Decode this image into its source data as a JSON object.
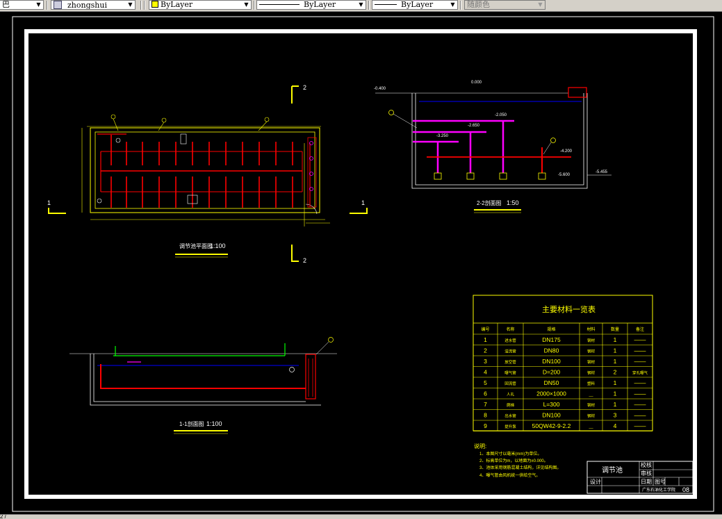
{
  "toolbar": {
    "left_fragment": "巴",
    "textstyle_value": "zhongshui",
    "layer_value": "ByLayer",
    "linetype_value": "ByLayer",
    "lineweight_value": "ByLayer",
    "plotstyle_value": "随颜色"
  },
  "statusbar": {
    "text": "2 /"
  },
  "drawing": {
    "plan": {
      "title": "调节池平面图",
      "scale": "1:100",
      "mark_left": "1",
      "mark_right": "1",
      "mark_top": "2",
      "mark_bottom": "2"
    },
    "section_11": {
      "title": "1-1剖面图",
      "scale": "1:100"
    },
    "section_22": {
      "title": "2-2剖面图",
      "scale": "1:50",
      "levels": {
        "top_left": "-0.400",
        "top": "0.000",
        "l1": "-2.050",
        "l2": "-2.650",
        "l3": "-3.250",
        "l4": "-4.200",
        "l5": "-5.600",
        "l6": "-5.455"
      }
    },
    "materials": {
      "title": "主要材料一览表",
      "headers": [
        "编号",
        "名称",
        "规格",
        "材料",
        "数量",
        "备注"
      ],
      "rows": [
        {
          "no": "1",
          "name": "进水管",
          "spec": "DN175",
          "mat": "钢材",
          "qty": "1",
          "note": "——"
        },
        {
          "no": "2",
          "name": "溢流管",
          "spec": "DN80",
          "mat": "钢材",
          "qty": "1",
          "note": "——"
        },
        {
          "no": "3",
          "name": "放空管",
          "spec": "DN100",
          "mat": "钢材",
          "qty": "1",
          "note": "——"
        },
        {
          "no": "4",
          "name": "曝气管",
          "spec": "D=200",
          "mat": "钢材",
          "qty": "2",
          "note": "穿孔曝气"
        },
        {
          "no": "5",
          "name": "回流管",
          "spec": "DN50",
          "mat": "塑料",
          "qty": "1",
          "note": "——"
        },
        {
          "no": "6",
          "name": "人孔",
          "spec": "2000×1000",
          "mat": "__",
          "qty": "1",
          "note": "——"
        },
        {
          "no": "7",
          "name": "爬梯",
          "spec": "L=300",
          "mat": "钢材",
          "qty": "1",
          "note": "——"
        },
        {
          "no": "8",
          "name": "出水管",
          "spec": "DN100",
          "mat": "钢材",
          "qty": "3",
          "note": "——"
        },
        {
          "no": "9",
          "name": "提升泵",
          "spec": "50QW42-9-2.2",
          "mat": "__",
          "qty": "4",
          "note": "——"
        }
      ]
    },
    "notes": {
      "heading": "说明:",
      "items": [
        "1、本图尺寸以毫米(mm)为单位。",
        "2、标高单位为m，以地面为±0.000。",
        "3、池体采用钢筋混凝土结构，详见结构图。",
        "4、曝气管由风机统一供给空气。"
      ]
    },
    "titleblock": {
      "name": "调节池",
      "school": "广东石油化工学院",
      "number": "08",
      "labels": [
        "设计",
        "校核",
        "审核",
        "日期",
        "图号"
      ]
    }
  },
  "colors": {
    "frame": "#ffffff",
    "drawing": "#ffff00",
    "pipe_red": "#ff0000",
    "pipe_magenta": "#ff00ff",
    "water_blue": "#0000ff",
    "pipe_green": "#00ff00"
  }
}
